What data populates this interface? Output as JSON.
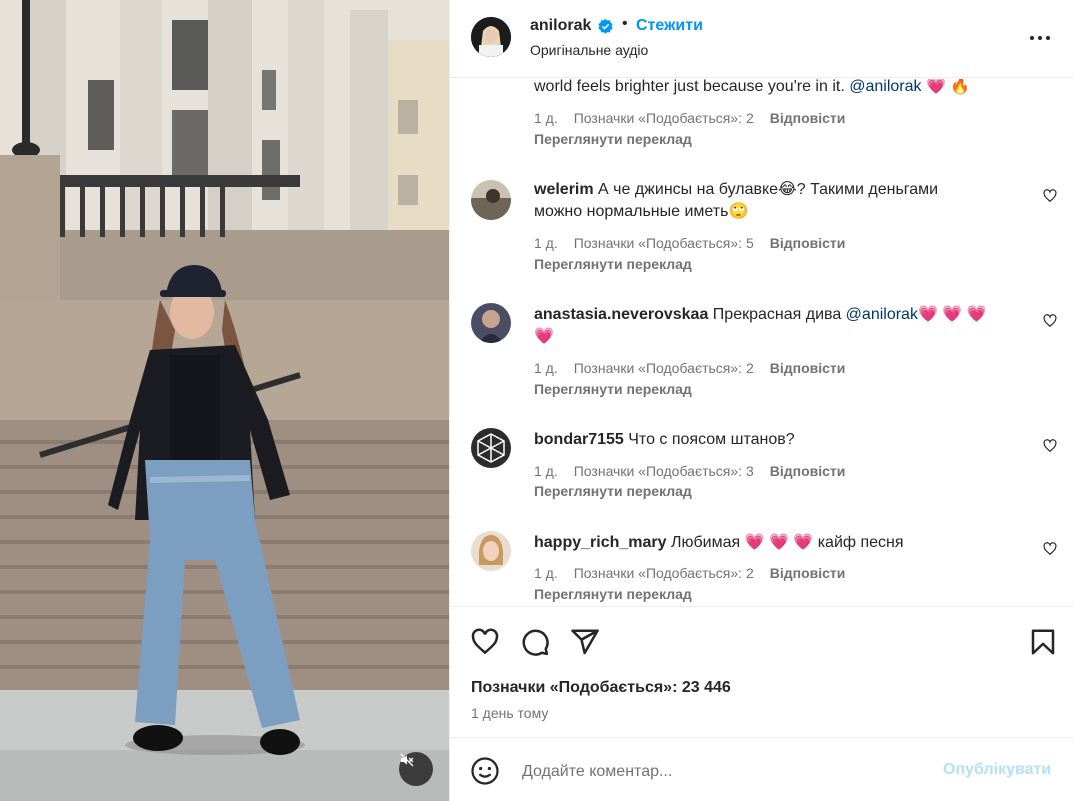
{
  "header": {
    "username": "anilorak",
    "dot": "•",
    "follow_label": "Стежити",
    "audio_label": "Оригінальне аудіо"
  },
  "comments": [
    {
      "text_before": "world feels brighter just because you're in it. ",
      "mention": "@anilorak",
      "emojis": "💗 🔥",
      "time": "1 д.",
      "likes": "Позначки «Подобається»: 2",
      "reply": "Відповісти",
      "translate": "Переглянути переклад"
    },
    {
      "username": "welerim",
      "text_line1": "А че джинсы на булавке😂? Такими деньгами",
      "text_line2": "можно нормальные иметь🙄",
      "time": "1 д.",
      "likes": "Позначки «Подобається»: 5",
      "reply": "Відповісти",
      "translate": "Переглянути переклад"
    },
    {
      "username": "anastasia.neverovskaa",
      "text": "Прекрасная дива ",
      "mention": "@anilorak",
      "emojis_line1": "💗 💗 💗",
      "emojis_line2": "💗",
      "time": "1 д.",
      "likes": "Позначки «Подобається»: 2",
      "reply": "Відповісти",
      "translate": "Переглянути переклад"
    },
    {
      "username": "bondar7155",
      "text": "Что с поясом штанов?",
      "time": "1 д.",
      "likes": "Позначки «Подобається»: 3",
      "reply": "Відповісти",
      "translate": "Переглянути переклад"
    },
    {
      "username": "happy_rich_mary",
      "text_before": "Любимая ",
      "emojis": "💗 💗 💗",
      "text_after": "кайф песня",
      "time": "1 д.",
      "likes": "Позначки «Подобається»: 2",
      "reply": "Відповісти",
      "translate": "Переглянути переклад"
    }
  ],
  "post": {
    "likes_count": "Позначки «Подобається»: 23 446",
    "time_ago": "1 день тому"
  },
  "composer": {
    "placeholder": "Додайте коментар...",
    "publish_label": "Опублікувати"
  },
  "colors": {
    "accent": "#0095f6",
    "publish_disabled": "#b2dffc",
    "secondary_text": "#737373",
    "mention": "#00376b",
    "heart": "#ed2f64"
  },
  "icons": [
    "verified-badge-icon",
    "more-options-icon",
    "heart-icon",
    "comment-icon",
    "share-icon",
    "bookmark-icon",
    "emoji-icon",
    "muted-speaker-icon"
  ]
}
